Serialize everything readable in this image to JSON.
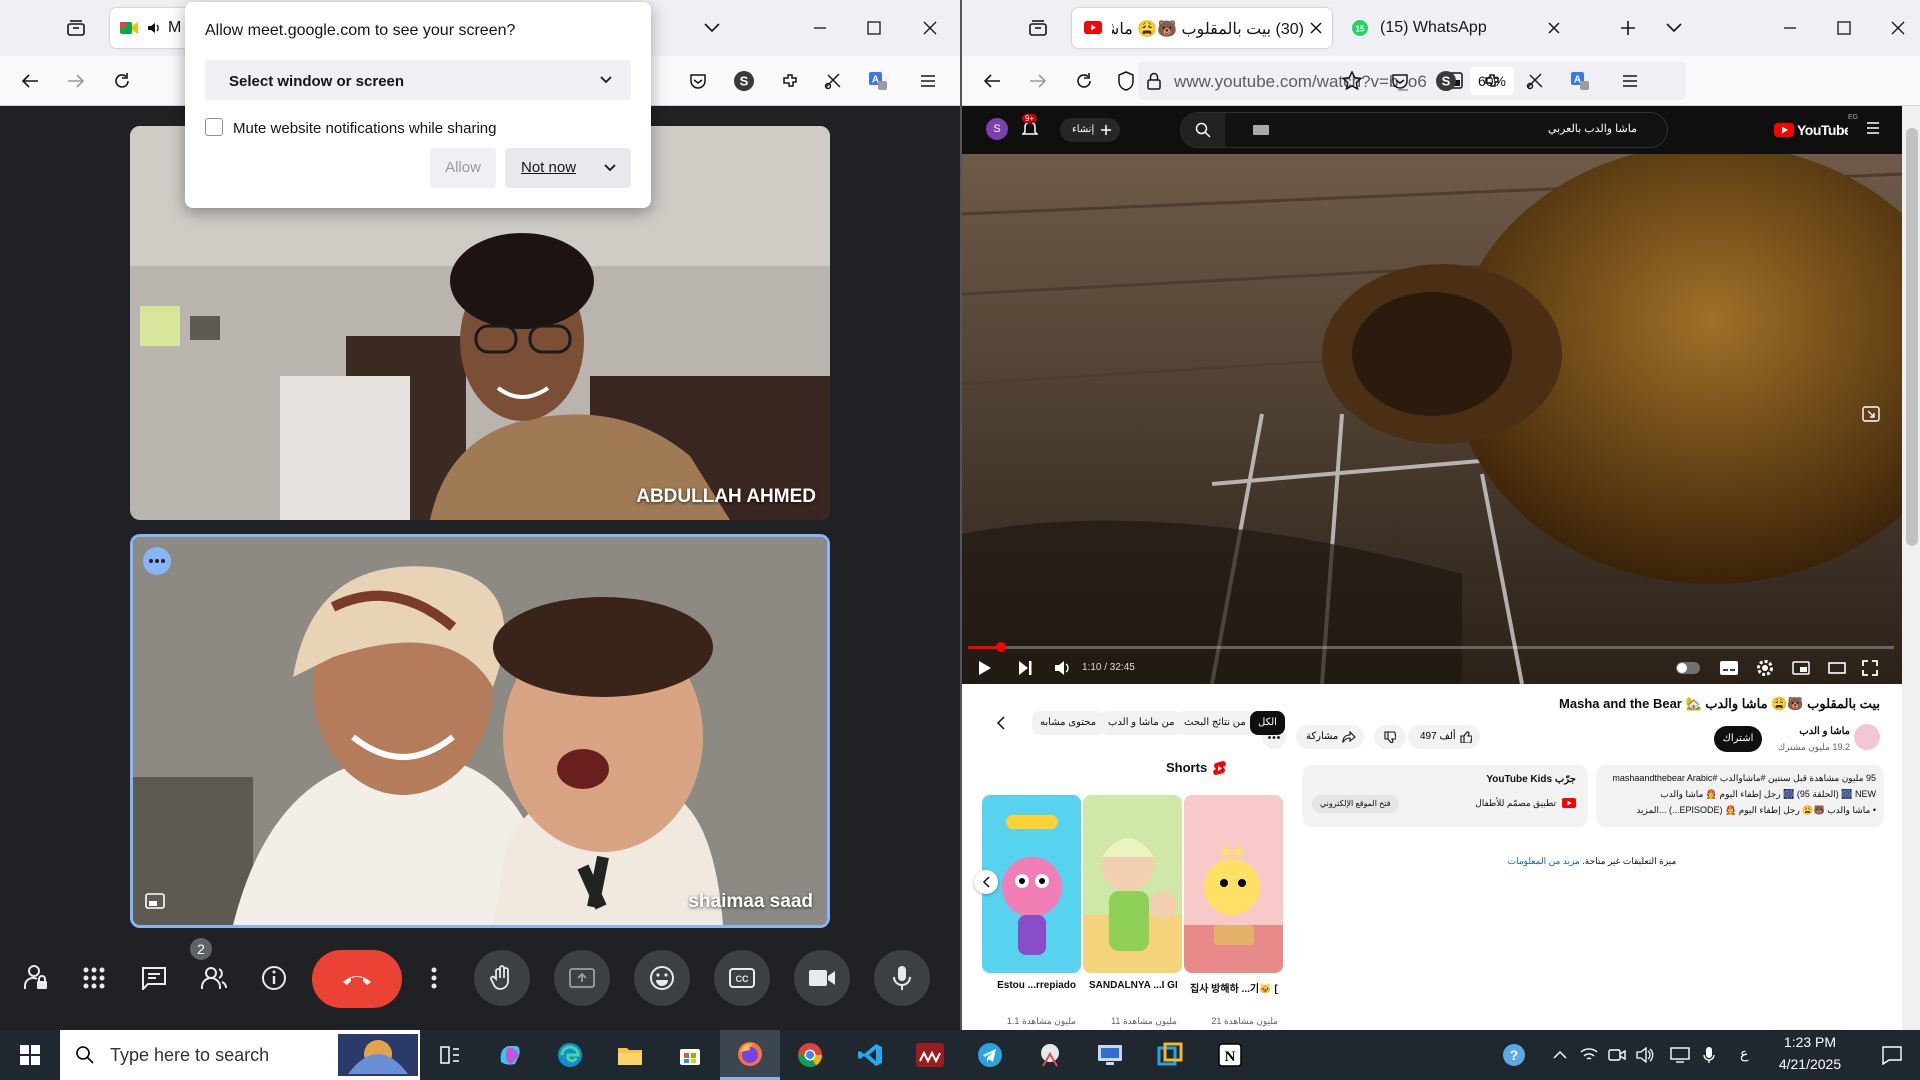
{
  "left_window": {
    "share_prompt": {
      "title": "Allow meet.google.com to see your screen?",
      "select_label": "Select window or screen",
      "mute_checkbox_label": "Mute website notifications while sharing",
      "allow_label": "Allow",
      "not_now_label": "Not now"
    },
    "tab_partial_label": "M",
    "participants": [
      {
        "name": "ABDULLAH AHMED"
      },
      {
        "name": "shaimaa saad"
      }
    ],
    "participant_count": "2"
  },
  "right_window": {
    "tabs": [
      {
        "label": "(30) بيت بالمقلوب 🐻😩 ماشـ",
        "active": true
      },
      {
        "label": "(15) WhatsApp",
        "badge": "15",
        "active": false
      }
    ],
    "url": "www.youtube.com/watch?v=b_o6",
    "zoom": "60%",
    "youtube": {
      "logo": "YouTube",
      "country": "EG",
      "avatar_letter": "S",
      "notif_count": "9+",
      "create_label": "إنشاء",
      "search_value": "ماشا والدب بالعربي",
      "player": {
        "time": "1:10 / 32:45",
        "progress": 0.036
      },
      "title": "بيت بالمقلوب 🐻😩 ماشا والدب 🏡 Masha and the Bear",
      "channel_name": "ماشا و الدب",
      "subscribers": "19.2 مليون مشترك",
      "subscribe_label": "اشتراك",
      "likes": "497 ألف",
      "share_label": "مشاركة",
      "chips": [
        "الكل",
        "من نتائج البحث",
        "من ماشا و الدب",
        "محتوى مشابه"
      ],
      "shorts_label": "Shorts",
      "shorts": [
        {
          "title": "Estou ...rrepiado",
          "views": "1.1 مليون مشاهدة"
        },
        {
          "title": "SANDALNYA ...I GEMBOK",
          "views": "11 مليون مشاهدة"
        },
        {
          "title": "집사 방해하 ...기🐱 [핑크",
          "views": "21 مليون مشاهدة"
        }
      ],
      "description": {
        "line1": "95 مليون مشاهدة قبل سنتين #ماشاوالدب #mashaandthebear Arabic",
        "line2": "NEW 🎆 (الحلقة 95) 🎆 رجل إطفاء اليوم 🧑‍🚒 ماشا والدب",
        "line3": "• ماشا والدب 🐻😩 رجل إطفاء اليوم 🧑‍🚒 (EPISODE...) ...المزيد"
      },
      "kids_card": {
        "title": "جرّب YouTube Kids",
        "sub": "تطبيق مصمّم للأطفال",
        "button": "فتح الموقع الإلكتروني"
      },
      "comments_note": "ميزة التعليقات غير متاحة.",
      "comments_link": "مزيد من المعلومات"
    }
  },
  "taskbar": {
    "search_placeholder": "Type here to search",
    "time": "1:23 PM",
    "date": "4/21/2025",
    "lang": "ع"
  }
}
